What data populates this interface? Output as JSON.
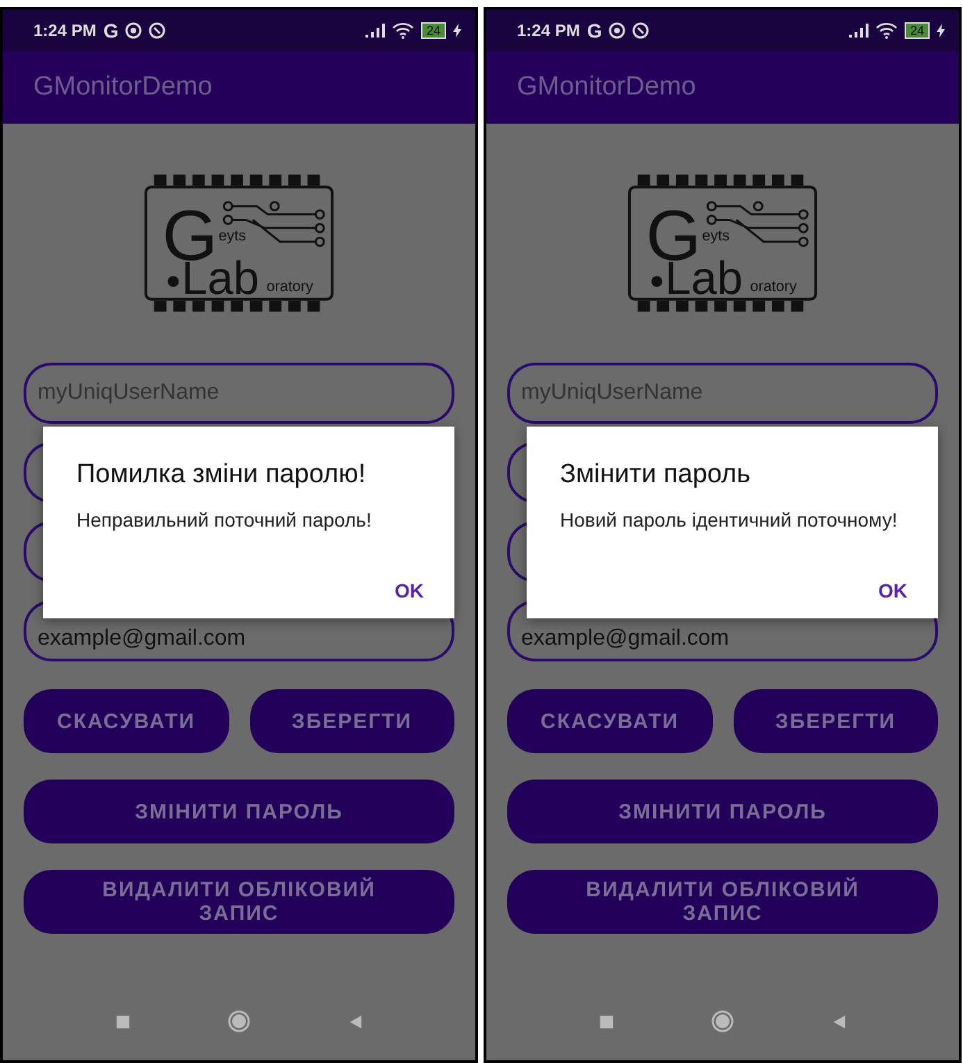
{
  "screens": [
    {
      "status_bar": {
        "time": "1:24 PM",
        "g_label": "G",
        "battery": "24"
      },
      "app_bar": {
        "title": "GMonitorDemo"
      },
      "logo": {
        "big_letter": "G",
        "small_top": "eyts",
        "big_word": "Lab",
        "small_bottom": "oratory"
      },
      "fields": [
        {
          "kind": "placeholder",
          "text": "myUniqUserName"
        },
        {
          "kind": "blank"
        },
        {
          "kind": "blank"
        },
        {
          "kind": "value",
          "text": "example@gmail.com"
        }
      ],
      "buttons": [
        {
          "label": "СКАСУВАТИ",
          "kind": "half"
        },
        {
          "label": "ЗБЕРЕГТИ",
          "kind": "half"
        },
        {
          "label": "ЗМІНИТИ ПАРОЛЬ",
          "kind": "full"
        },
        {
          "label": "ВИДАЛИТИ ОБЛІКОВИЙ ЗАПИС",
          "kind": "full"
        }
      ],
      "dialog": {
        "title": "Помилка зміни паролю!",
        "message": "Неправильний поточний пароль!",
        "action": "OK"
      }
    },
    {
      "status_bar": {
        "time": "1:24 PM",
        "g_label": "G",
        "battery": "24"
      },
      "app_bar": {
        "title": "GMonitorDemo"
      },
      "logo": {
        "big_letter": "G",
        "small_top": "eyts",
        "big_word": "Lab",
        "small_bottom": "oratory"
      },
      "fields": [
        {
          "kind": "placeholder",
          "text": "myUniqUserName"
        },
        {
          "kind": "blank"
        },
        {
          "kind": "blank"
        },
        {
          "kind": "value",
          "text": "example@gmail.com"
        }
      ],
      "buttons": [
        {
          "label": "СКАСУВАТИ",
          "kind": "half"
        },
        {
          "label": "ЗБЕРЕГТИ",
          "kind": "half"
        },
        {
          "label": "ЗМІНИТИ ПАРОЛЬ",
          "kind": "full"
        },
        {
          "label": "ВИДАЛИТИ ОБЛІКОВИЙ ЗАПИС",
          "kind": "full"
        }
      ],
      "dialog": {
        "title": "Змінити пароль",
        "message": "Новий пароль ідентичний поточному!",
        "action": "OK"
      }
    }
  ]
}
